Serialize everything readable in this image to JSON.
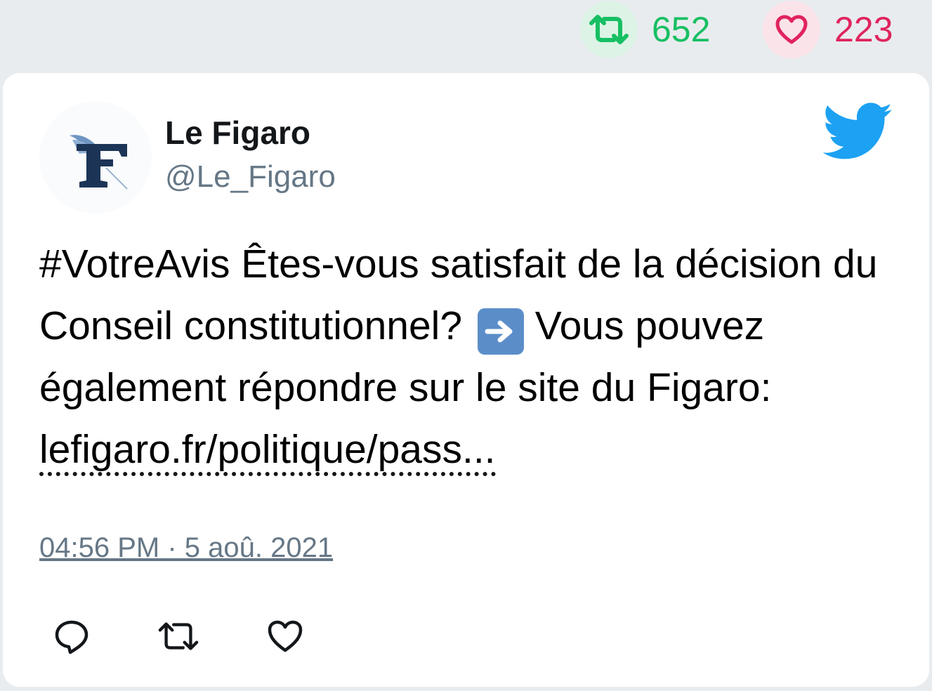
{
  "stats": {
    "retweets": "652",
    "likes": "223",
    "retweet_icon": "retweet-icon",
    "like_icon": "heart-icon",
    "retweet_color": "#17bf63",
    "like_color": "#e0245e"
  },
  "author": {
    "name": "Le Figaro",
    "handle": "@Le_Figaro",
    "avatar_icon": "le-figaro-logo"
  },
  "tweet": {
    "hashtag": "#VotreAvis",
    "text_part1": " Êtes-vous satisfait de la décision du Conseil constitutionnel?",
    "emoji": "right-arrow-emoji",
    "text_part2": " Vous pouvez également répondre sur le site du Figaro: ",
    "link": "lefigaro.fr/politique/pass...",
    "timestamp": "04:56 PM · 5 aoû. 2021"
  },
  "brand_icon": "twitter-bird-icon",
  "actions": [
    {
      "icon": "reply-icon"
    },
    {
      "icon": "retweet-icon"
    },
    {
      "icon": "heart-icon"
    }
  ],
  "colors": {
    "twitter_blue": "#1da1f2",
    "handle_gray": "#657786"
  }
}
